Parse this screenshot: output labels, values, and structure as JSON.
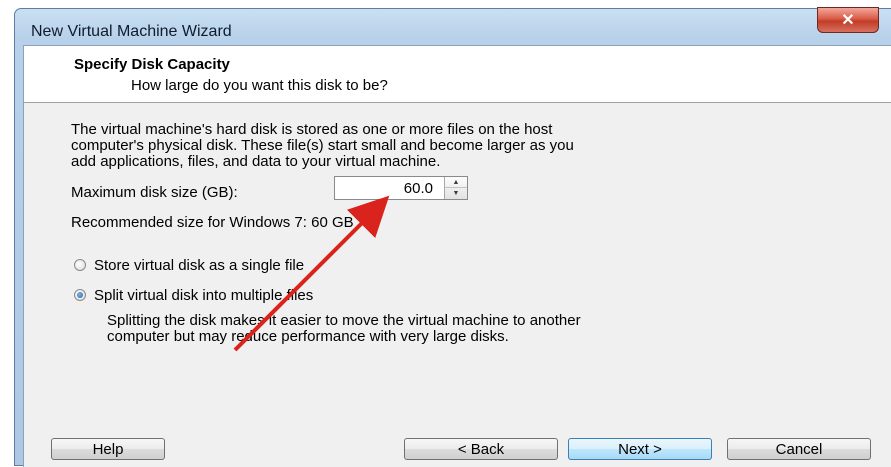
{
  "window": {
    "title": "New Virtual Machine Wizard",
    "close_icon": "close-icon"
  },
  "header": {
    "title": "Specify Disk Capacity",
    "subtitle": "How large do you want this disk to be?"
  },
  "main": {
    "description_lines": [
      "The virtual machine's hard disk is stored as one or more files on the host",
      "computer's physical disk. These file(s) start small and become larger as you",
      "add applications, files, and data to your virtual machine."
    ],
    "max_size_label": "Maximum disk size (GB):",
    "max_size_value": "60.0",
    "recommended_text": "Recommended size for Windows 7: 60 GB",
    "options": [
      {
        "label": "Store virtual disk as a single file",
        "selected": false
      },
      {
        "label": "Split virtual disk into multiple files",
        "selected": true
      }
    ],
    "split_description_lines": [
      "Splitting the disk makes it easier to move the virtual machine to another",
      "computer but may reduce performance with very large disks."
    ]
  },
  "footer": {
    "help_label": "Help",
    "back_label": "< Back",
    "next_label": "Next >",
    "cancel_label": "Cancel"
  },
  "colors": {
    "annotation_arrow": "#d9231c",
    "default_button_border": "#3c7fb1"
  }
}
